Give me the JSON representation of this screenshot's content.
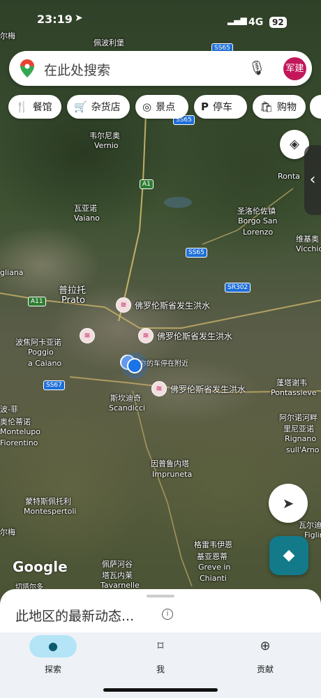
{
  "status": {
    "time": "23:19",
    "network": "4G",
    "battery": "92"
  },
  "search": {
    "placeholder": "在此处搜索",
    "avatar": "军建"
  },
  "chips": [
    {
      "icon": "🍴",
      "label": "餐馆"
    },
    {
      "icon": "🛒",
      "label": "杂货店"
    },
    {
      "icon": "◎",
      "label": "景点"
    },
    {
      "icon": "P",
      "label": "停车"
    },
    {
      "icon": "🛍",
      "label": "购物"
    }
  ],
  "labels": {
    "l1": "尔梅",
    "l2": "佩波利堡",
    "l3": "韦尔尼奥",
    "l4": "Vernio",
    "l5": "瓦亚诺",
    "l6": "Vaiano",
    "l7": "圣洛伦佐镇",
    "l8": "Borgo San",
    "l9": "Lorenzo",
    "l10": "维基奥",
    "l11": "Vicchio",
    "l12": "普拉托",
    "l13": "Prato",
    "l14": "gliana",
    "l15": "波焦阿卡亚诺",
    "l16": "Poggio",
    "l17": "a Caiano",
    "l18": "斯坎迪奇",
    "l19": "Scandicci",
    "l20": "波-菲",
    "l21": "奥伦蒂诺",
    "l22": "Montelupo",
    "l23": "Fiorentino",
    "l24": "因普鲁内塔",
    "l25": "Impruneta",
    "l26": "蒙特斯佩托利",
    "l27": "Montespertoli",
    "l28": "格雷韦伊恩",
    "l29": "基亚恩蒂",
    "l30": "Greve in",
    "l31": "Chianti",
    "l32": "佩萨河谷",
    "l33": "塔瓦内莱",
    "l34": "Tavarnelle",
    "l35": "蓬塔谢韦",
    "l36": "Pontassieve",
    "l37": "阿尔诺河畔",
    "l38": "里尼亚诺",
    "l39": "Rignano",
    "l40": "sull'Arno",
    "l41": "Ronta",
    "l42": "你的车停在附近",
    "l43": "切塔尔多",
    "l44": "尔梅",
    "l45": "Figlin",
    "l46": "瓦尔迪"
  },
  "shields": {
    "s1": "SS65",
    "s2": "SS65",
    "s3": "A1",
    "s4": "SS65",
    "s5": "SR302",
    "s6": "A11",
    "s7": "SS67"
  },
  "floods": [
    "佛罗伦斯省发生洪水",
    "佛罗伦斯省发生洪水",
    "佛罗伦斯省发生洪水"
  ],
  "watermark_map": "Google",
  "sheet": {
    "title": "此地区的最新动态..."
  },
  "nav": [
    {
      "label": "探索"
    },
    {
      "label": "我"
    },
    {
      "label": "贡献"
    }
  ],
  "colors": {
    "accent": "#c2185b",
    "nav_active": "#b3e5f7",
    "directions": "#137a8a",
    "location": "#1a73e8"
  }
}
